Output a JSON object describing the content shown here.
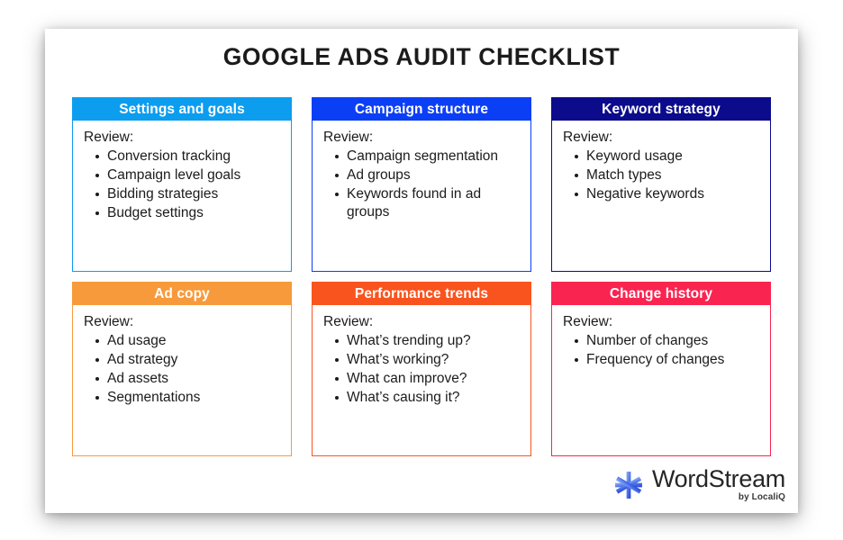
{
  "title": "GOOGLE ADS AUDIT CHECKLIST",
  "review_label": "Review:",
  "cards": [
    {
      "heading": "Settings and goals",
      "color": "#0C9DEF",
      "review": "Review:",
      "items": [
        "Conversion tracking",
        "Campaign level goals",
        "Bidding strategies",
        "Budget settings"
      ]
    },
    {
      "heading": "Campaign structure",
      "color": "#0B3FF5",
      "review": "Review:",
      "items": [
        "Campaign segmentation",
        "Ad groups",
        "Keywords found in ad groups"
      ]
    },
    {
      "heading": "Keyword strategy",
      "color": "#0B0B8C",
      "review": "Review:",
      "items": [
        "Keyword usage",
        "Match types",
        "Negative keywords"
      ]
    },
    {
      "heading": "Ad copy",
      "color": "#F79A3C",
      "review": "Review:",
      "items": [
        "Ad usage",
        "Ad strategy",
        "Ad assets",
        "Segmentations"
      ]
    },
    {
      "heading": "Performance trends",
      "color": "#F9541E",
      "review": "Review:",
      "items": [
        "What’s trending up?",
        "What’s working?",
        "What can improve?",
        "What’s causing it?"
      ]
    },
    {
      "heading": "Change history",
      "color": "#FA2450",
      "review": "Review:",
      "items": [
        "Number of changes",
        "Frequency of changes"
      ]
    }
  ],
  "logo": {
    "mark_icon": "wordstream-asterisk-icon",
    "mark_color_light": "#7EA6F5",
    "mark_color_dark": "#2B4FE0",
    "wordmark": "WordStream",
    "tagline": "by LocaliQ"
  }
}
